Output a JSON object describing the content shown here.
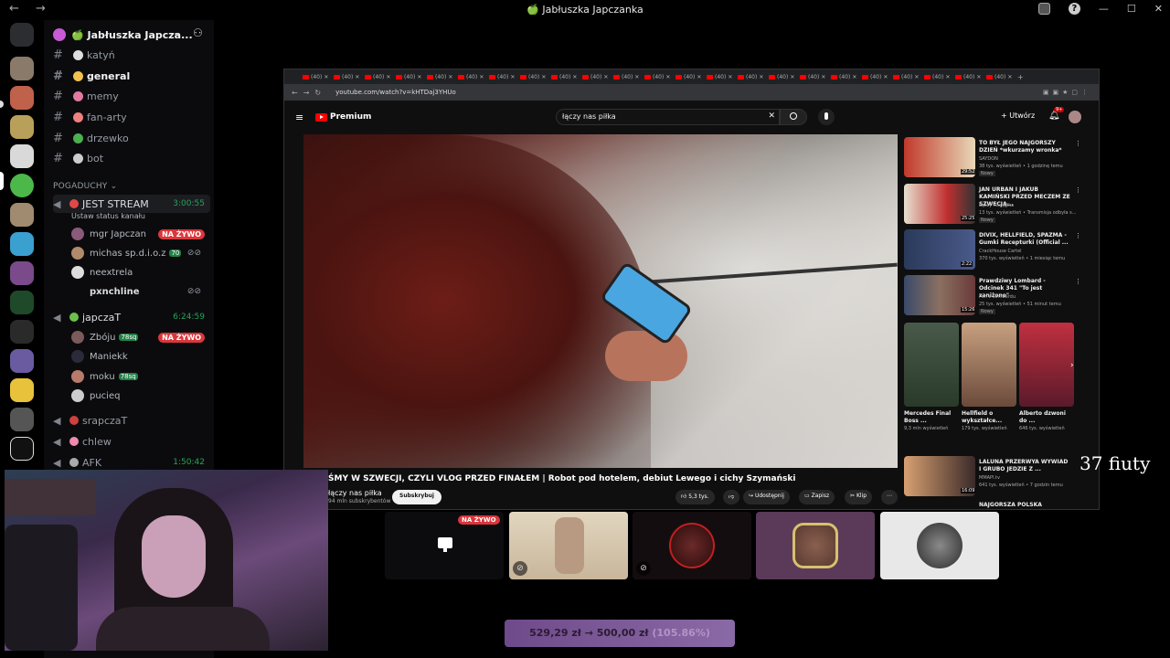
{
  "titlebar": {
    "back": "←",
    "forward": "→",
    "title": "🍏 Jabłuszka Japczanka",
    "minimize": "—",
    "maximize": "☐",
    "close": "✕"
  },
  "server": {
    "name": "🍏 Jabłuszka Japcza...",
    "channels": [
      {
        "name": "katyń",
        "active": false
      },
      {
        "name": "general",
        "active": true
      },
      {
        "name": "memy",
        "active": false
      },
      {
        "name": "fan-arty",
        "active": false
      },
      {
        "name": "drzewko",
        "active": false
      },
      {
        "name": "bot",
        "active": false
      }
    ],
    "category": "POGADUCHY"
  },
  "voice": {
    "jest_stream": {
      "name": "JEST STREAM",
      "timer": "3:00:55",
      "status": "Ustaw status kanału",
      "users": [
        {
          "name": "mgr Japczan",
          "live": "NA ŻYWO"
        },
        {
          "name": "michas sp.d.i.o.z",
          "tag": "70"
        },
        {
          "name": "neextrela"
        },
        {
          "name": "pxnchline"
        }
      ]
    },
    "japczat": {
      "name": "japczaT",
      "timer": "6:24:59",
      "users": [
        {
          "name": "Zbóju",
          "tag": "78sq",
          "live": "NA ŻYWO"
        },
        {
          "name": "Maniekk"
        },
        {
          "name": "moku",
          "tag": "78sq"
        },
        {
          "name": "pucieq"
        }
      ]
    },
    "srapczat": {
      "name": "srapczaT"
    },
    "chlew": {
      "name": "chlew"
    },
    "afk": {
      "name": "AFK",
      "timer": "1:50:42"
    }
  },
  "browser": {
    "tab_label": "(40)",
    "url": "youtube.com/watch?v=kHTDaj3YHUo",
    "youtube": {
      "logo": "Premium",
      "search_value": "łączy nas piłka",
      "create_label": "Utwórz",
      "notif_count": "9+",
      "video_title": "ŚMY W SZWECJI, CZYLI VLOG PRZED FINAŁEM | Robot pod hotelem, debiut Lewego i cichy Szymański",
      "channel": "łączy nas piłka",
      "subscribers": "94 mln subskrybentów",
      "subscribe": "Subskrybuj",
      "likes": "5,3 tys.",
      "share": "Udostępnij",
      "save": "Zapisz",
      "clip": "Klip",
      "related": [
        {
          "title": "TO BYŁ JEGO NAJGORSZY DZIEŃ *wkurzamy wronka*",
          "channel": "SAYDON",
          "meta": "38 tys. wyświetleń • 1 godzinę temu",
          "new": "Nowy",
          "duration": "29:52"
        },
        {
          "title": "JAN URBAN I JAKUB KAMIŃSKI PRZED MECZEM ZE SZWECJĄ...",
          "channel": "Łączy nas piłka",
          "meta": "13 tys. wyświetleń • Transmisja odbyła s...",
          "new": "Nowy",
          "duration": "25:25"
        },
        {
          "title": "DIVIX, HELLFIELD, SPAZMA - Gumki Recepturki (Official ...",
          "channel": "CrackHouse Cartel",
          "meta": "370 tys. wyświetleń • 1 miesiąc temu",
          "new": "",
          "duration": "2:22"
        },
        {
          "title": "Prawdziwy Lombard - Odcinek 341 \"To jest zaniżone\"",
          "channel": "Pan z Lombardu",
          "meta": "25 tys. wyświetleń • 51 minut temu",
          "new": "Nowy",
          "duration": "15:26"
        }
      ],
      "shorts": [
        {
          "title": "Mercedes Final Boss ...",
          "meta": "9,3 mln wyświetleń"
        },
        {
          "title": "Hellfield o wykształce...",
          "meta": "179 tys. wyświetleń"
        },
        {
          "title": "Alberto dzwoni do ...",
          "meta": "646 tys. wyświetleń"
        }
      ],
      "more": [
        {
          "title": "LALUNA PRZERWYA WYWIAD I GRUBO JEDZIE Z ...",
          "channel": "MMAPl.tv",
          "meta": "641 tys. wyświetleń • 7 godzin temu",
          "duration": "16:09"
        },
        {
          "title": "NAJGORSZA POLSKA"
        }
      ]
    }
  },
  "tiles": {
    "live_label": "NA ŻYWO"
  },
  "overlay": {
    "text": "37 fiuty"
  },
  "donation": {
    "text": "529,29 zł → 500,00 zł",
    "percent": "(105.86%)"
  },
  "colors": {
    "discord_green": "#23a55a",
    "live_red": "#da373c",
    "youtube_red": "#ff0000",
    "donation_purple": "#8a6aa6"
  }
}
